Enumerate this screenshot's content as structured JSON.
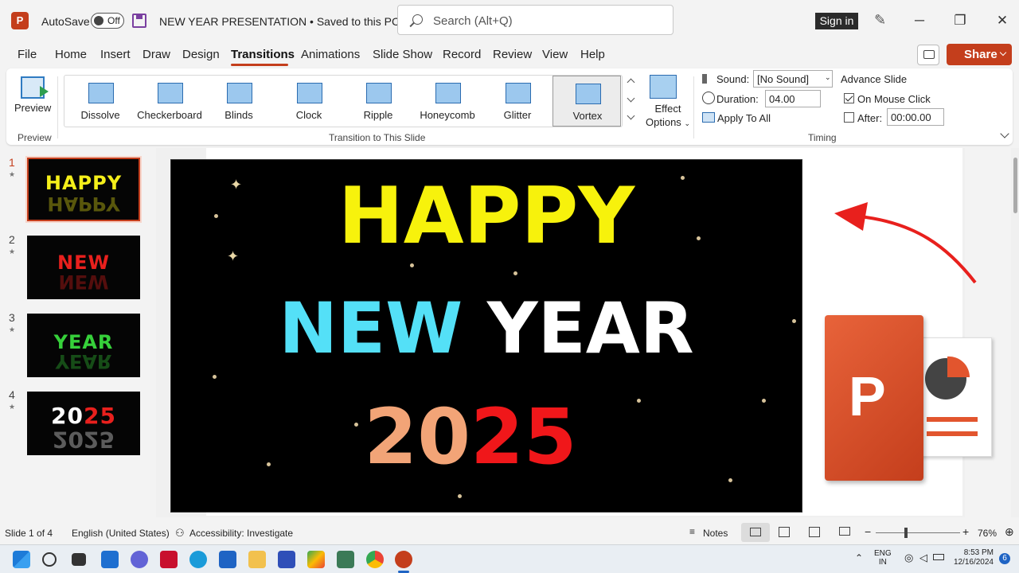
{
  "title_bar": {
    "autosave_label": "AutoSave",
    "autosave_state": "Off",
    "doc_title": "NEW YEAR PRESENTATION • Saved to this PC",
    "search_placeholder": "Search (Alt+Q)",
    "signin": "Sign in",
    "logo": "P"
  },
  "menu": {
    "items": [
      "File",
      "Home",
      "Insert",
      "Draw",
      "Design",
      "Transitions",
      "Animations",
      "Slide Show",
      "Record",
      "Review",
      "View",
      "Help"
    ],
    "active": "Transitions",
    "share": "Share"
  },
  "ribbon": {
    "preview_label": "Preview",
    "preview_group": "Preview",
    "transitions": [
      "Dissolve",
      "Checkerboard",
      "Blinds",
      "Clock",
      "Ripple",
      "Honeycomb",
      "Glitter",
      "Vortex"
    ],
    "selected": "Vortex",
    "effect_options": "Effect",
    "effect_options2": "Options",
    "group_transition": "Transition to This Slide",
    "sound_label": "Sound:",
    "sound_value": "[No Sound]",
    "duration_label": "Duration:",
    "duration_value": "04.00",
    "apply_all": "Apply To All",
    "advance_slide": "Advance Slide",
    "on_mouse_click": "On Mouse Click",
    "on_mouse_click_checked": true,
    "after_label": "After:",
    "after_value": "00:00.00",
    "group_timing": "Timing"
  },
  "slides": [
    {
      "num": "1",
      "word": "HAPPY",
      "color": "#f5ef1a"
    },
    {
      "num": "2",
      "word": "NEW",
      "color": "#e8201d"
    },
    {
      "num": "3",
      "word": "YEAR",
      "color": "#36d03a"
    },
    {
      "num": "4",
      "word_a": "20",
      "word_b": "25",
      "color_a": "#ffffff",
      "color_b": "#e8201d"
    }
  ],
  "main_slide": {
    "line1": "HAPPY",
    "line2a": "NEW",
    "line2b": "YEAR",
    "line3a": "20",
    "line3b": "25",
    "colors": {
      "happy": "#f7f20c",
      "new": "#54e0f7",
      "year": "#ffffff",
      "twenty": "#f2a477",
      "twentyfive": "#f0171a"
    }
  },
  "status_bar": {
    "slide_info": "Slide 1 of 4",
    "language": "English (United States)",
    "accessibility": "Accessibility: Investigate",
    "notes": "Notes",
    "zoom": "76%"
  },
  "taskbar": {
    "lang1": "ENG",
    "lang2": "IN",
    "time": "8:53 PM",
    "date": "12/16/2024",
    "badge": "6"
  }
}
